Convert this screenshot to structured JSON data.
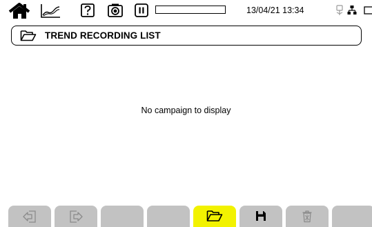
{
  "status_bar": {
    "icons": [
      "home-icon",
      "trend-chart-icon",
      "help-icon",
      "camera-icon",
      "pause-icon",
      "usb-icon",
      "network-icon",
      "battery-icon"
    ],
    "recording_progress": 0,
    "datetime": "13/04/21 13:34"
  },
  "title_bar": {
    "icon": "folder-icon",
    "title": "TREND RECORDING LIST"
  },
  "main": {
    "empty_message": "No campaign to display"
  },
  "softkeys": [
    {
      "icon": "exit-left-icon",
      "active": false
    },
    {
      "icon": "exit-right-icon",
      "active": false
    },
    {
      "icon": "",
      "active": false
    },
    {
      "icon": "",
      "active": false
    },
    {
      "icon": "folder-open-icon",
      "active": true
    },
    {
      "icon": "save-icon",
      "active": false
    },
    {
      "icon": "trash-icon",
      "active": false
    },
    {
      "icon": "",
      "active": false
    }
  ],
  "colors": {
    "active_softkey": "#f2f200",
    "inactive_softkey": "#c2c2c2",
    "disabled_icon": "#8a8a8a"
  }
}
